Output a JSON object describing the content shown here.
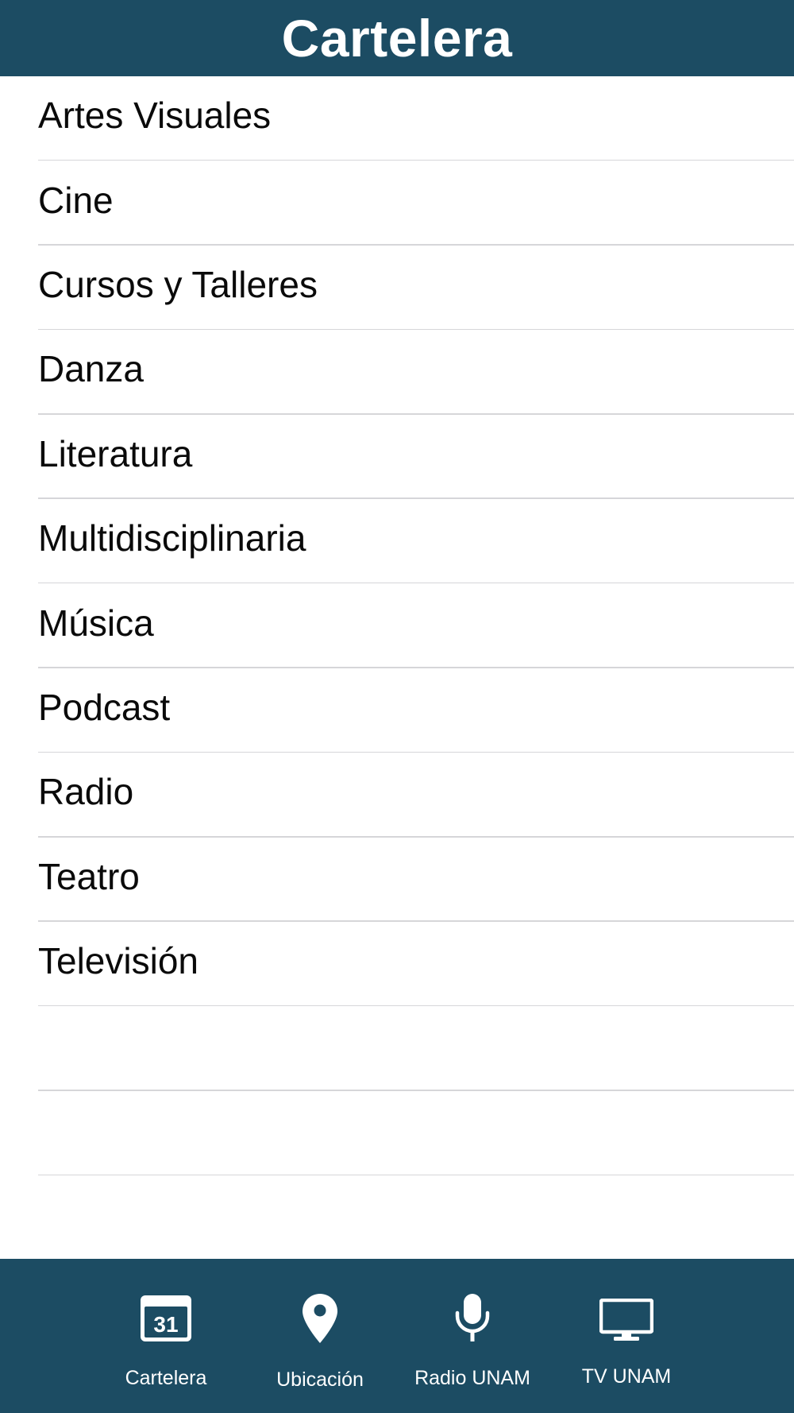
{
  "nav": {
    "title": "Cartelera"
  },
  "list": {
    "items": [
      {
        "label": "Artes Visuales"
      },
      {
        "label": "Cine"
      },
      {
        "label": "Cursos y Talleres"
      },
      {
        "label": "Danza"
      },
      {
        "label": "Literatura"
      },
      {
        "label": "Multidisciplinaria"
      },
      {
        "label": "Música"
      },
      {
        "label": "Podcast"
      },
      {
        "label": "Radio"
      },
      {
        "label": "Teatro"
      },
      {
        "label": "Televisión"
      }
    ]
  },
  "tab_bar": {
    "tabs": [
      {
        "label": "Cartelera",
        "icon": "calendar-icon",
        "icon_text": "31"
      },
      {
        "label": "Ubicación",
        "icon": "location-pin-icon"
      },
      {
        "label": "Radio UNAM",
        "icon": "microphone-icon"
      },
      {
        "label": "TV UNAM",
        "icon": "tv-monitor-icon"
      }
    ]
  },
  "colors": {
    "bar_background": "#1c4c63",
    "bar_text": "#ffffff",
    "separator": "#d6d6d9",
    "row_text": "#0a0a0a"
  }
}
